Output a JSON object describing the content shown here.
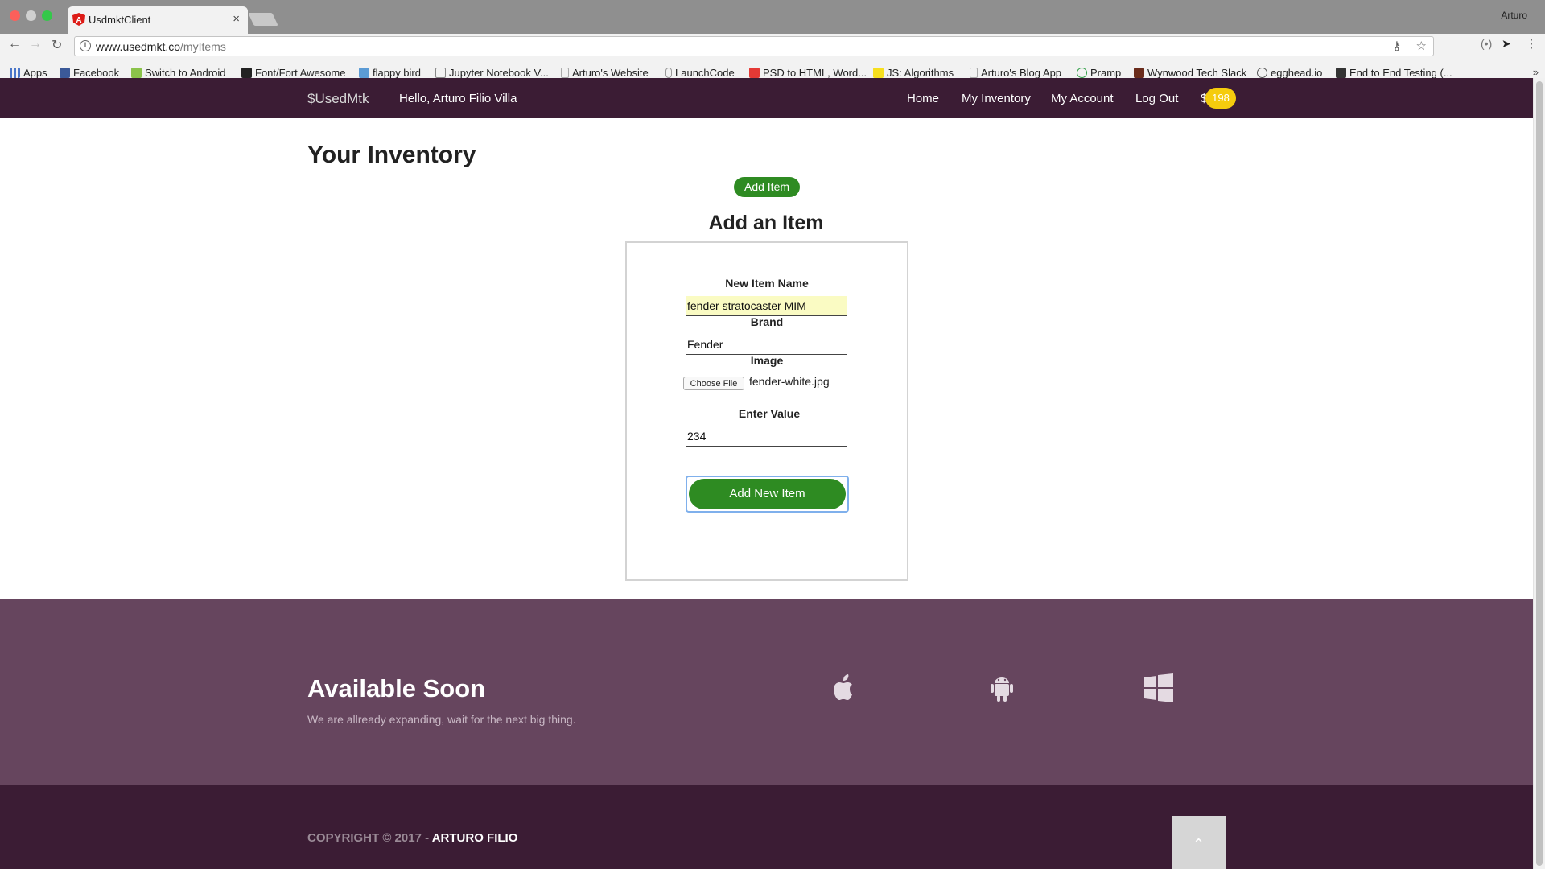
{
  "browser": {
    "tab_title": "UsdmktClient",
    "tab_close": "×",
    "profile_name": "Arturo",
    "url_host": "www.usedmkt.co",
    "url_path": "/myItems",
    "bookmarks": [
      {
        "label": "Apps",
        "color": "#4a76c9"
      },
      {
        "label": "Facebook",
        "color": "#3b5998"
      },
      {
        "label": "Switch to Android",
        "color": "#8bc34a"
      },
      {
        "label": "Font/Fort Awesome",
        "color": "#222222"
      },
      {
        "label": "flappy bird",
        "color": "#5b9bd5"
      },
      {
        "label": "Jupyter Notebook V...",
        "color": "#888888"
      },
      {
        "label": "Arturo's Website",
        "color": "#bbbbbb"
      },
      {
        "label": "LaunchCode",
        "color": "#999999"
      },
      {
        "label": "PSD to HTML, Word...",
        "color": "#e53935"
      },
      {
        "label": "JS: Algorithms",
        "color": "#f7df1e"
      },
      {
        "label": "Arturo's Blog App",
        "color": "#bbbbbb"
      },
      {
        "label": "Pramp",
        "color": "#2e9e44"
      },
      {
        "label": "Wynwood Tech Slack",
        "color": "#6b2c1c"
      },
      {
        "label": "egghead.io",
        "color": "#555555"
      },
      {
        "label": "End to End Testing (...",
        "color": "#333333"
      }
    ]
  },
  "navbar": {
    "brand": "$UsedMtk",
    "greeting": "Hello, Arturo Filio Villa",
    "links": [
      "Home",
      "My Inventory",
      "My Account",
      "Log Out"
    ],
    "currency": "$",
    "balance": "198",
    "badge_color": "#f5cc0d"
  },
  "main": {
    "title": "Your Inventory",
    "add_item_button": "Add Item",
    "form_title": "Add an Item",
    "fields": {
      "name_label": "New Item Name",
      "name_value": "fender stratocaster MIM",
      "brand_label": "Brand",
      "brand_value": "Fender",
      "image_label": "Image",
      "file_button": "Choose File",
      "file_name": "fender-white.jpg",
      "value_label": "Enter Value",
      "value_value": "234"
    },
    "submit_button": "Add New Item",
    "accent_color": "#2e8b22"
  },
  "footer": {
    "soon_title": "Available Soon",
    "soon_subtitle": "We are allready expanding, wait for the next big thing.",
    "platforms": [
      "apple-icon",
      "android-icon",
      "windows-icon"
    ],
    "copyright": "COPYRIGHT © 2017 -",
    "author": "ARTURO FILIO",
    "to_top_icon": "chevron-up-icon",
    "colors": {
      "top": "#66455e",
      "bottom": "#3b1c34"
    }
  }
}
